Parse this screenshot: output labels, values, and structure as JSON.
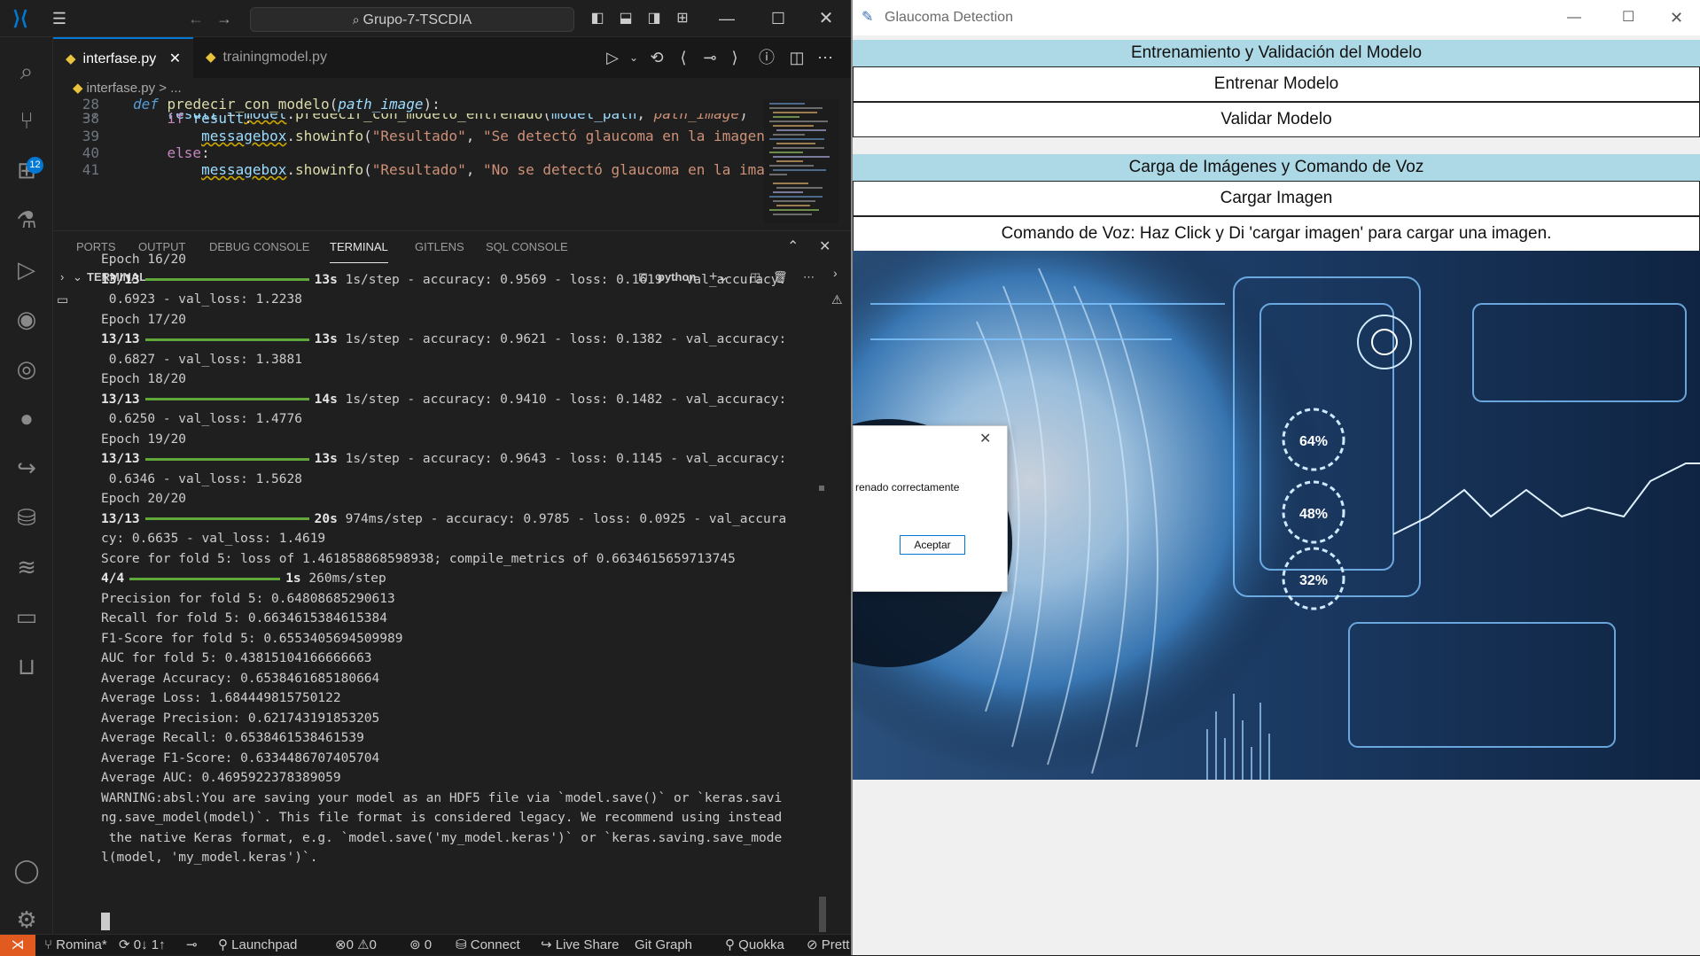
{
  "vscode": {
    "search_text": "Grupo-7-TSCDIA",
    "tabs": [
      {
        "label": "interfase.py"
      },
      {
        "label": "trainingmodel.py"
      }
    ],
    "breadcrumb": "interfase.py  > ...",
    "badge_count": "12",
    "code_lines": [
      {
        "num": "28",
        "text": "def predecir_con_modelo(path_image):"
      },
      {
        "num": "37",
        "text": "    result = model.predecir_con_modelo_entrenado(model_path, path_image)"
      },
      {
        "num": "38",
        "text": "    if result:"
      },
      {
        "num": "39",
        "text": "        messagebox.showinfo(\"Resultado\", \"Se detectó glaucoma en la imagen"
      },
      {
        "num": "40",
        "text": "    else:"
      },
      {
        "num": "41",
        "text": "        messagebox.showinfo(\"Resultado\", \"No se detectó glaucoma en la ima"
      }
    ],
    "panel_tabs": [
      "PORTS",
      "OUTPUT",
      "DEBUG CONSOLE",
      "TERMINAL",
      "GITLENS",
      "SQL CONSOLE"
    ],
    "terminal_header": "TERMINAL",
    "terminal_shell": "python",
    "terminal_lines": [
      "Epoch 16/20",
      "13/13|13s|1s/step - accuracy: 0.9569 - loss: 0.1619 - val_accuracy:",
      " 0.6923 - val_loss: 1.2238",
      "Epoch 17/20",
      "13/13|13s|1s/step - accuracy: 0.9621 - loss: 0.1382 - val_accuracy:",
      " 0.6827 - val_loss: 1.3881",
      "Epoch 18/20",
      "13/13|14s|1s/step - accuracy: 0.9410 - loss: 0.1482 - val_accuracy:",
      " 0.6250 - val_loss: 1.4776",
      "Epoch 19/20",
      "13/13|13s|1s/step - accuracy: 0.9643 - loss: 0.1145 - val_accuracy:",
      " 0.6346 - val_loss: 1.5628",
      "Epoch 20/20",
      "13/13|20s|974ms/step - accuracy: 0.9785 - loss: 0.0925 - val_accura",
      "cy: 0.6635 - val_loss: 1.4619",
      "Score for fold 5: loss of 1.461858868598938; compile_metrics of 0.6634615659713745",
      "4/4|1s|260ms/step",
      "Precision for fold 5: 0.64808685290613",
      "Recall for fold 5: 0.6634615384615384",
      "F1-Score for fold 5: 0.6553405694509989",
      "AUC for fold 5: 0.43815104166666663",
      "Average Accuracy: 0.6538461685180664",
      "Average Loss: 1.684449815750122",
      "Average Precision: 0.621743191853205",
      "Average Recall: 0.6538461538461539",
      "Average F1-Score: 0.6334486707405704",
      "Average AUC: 0.4695922378389059",
      "WARNING:absl:You are saving your model as an HDF5 file via `model.save()` or `keras.savi",
      "ng.save_model(model)`. This file format is considered legacy. We recommend using instead",
      " the native Keras format, e.g. `model.save('my_model.keras')` or `keras.saving.save_mode",
      "l(model, 'my_model.keras')`."
    ],
    "status": {
      "branch": "Romina*",
      "sync": "0↓ 1↑",
      "launchpad": "Launchpad",
      "errors": "0",
      "warnings": "0",
      "ports": "0",
      "connect": "Connect",
      "live_share": "Live Share",
      "git_graph": "Git Graph",
      "quokka": "Quokka",
      "prettier": "Prett"
    }
  },
  "glaucoma_app": {
    "window_title": "Glaucoma Detection",
    "section1_title": "Entrenamiento y Validación del Modelo",
    "train_button": "Entrenar Modelo",
    "validate_button": "Validar Modelo",
    "section2_title": "Carga de Imágenes y Comando de Voz",
    "load_button": "Cargar Imagen",
    "voice_button": "Comando de Voz: Haz Click y Di 'cargar imagen' para cargar una imagen.",
    "hud_labels": [
      "64%",
      "48%",
      "32%"
    ],
    "dialog": {
      "message": "renado correctamente",
      "ok_button": "Aceptar"
    }
  },
  "colors": {
    "accent": "#0078d4",
    "section_bg": "#add8e6",
    "progress_green": "#5fa839",
    "remote_orange": "#e15a20"
  }
}
